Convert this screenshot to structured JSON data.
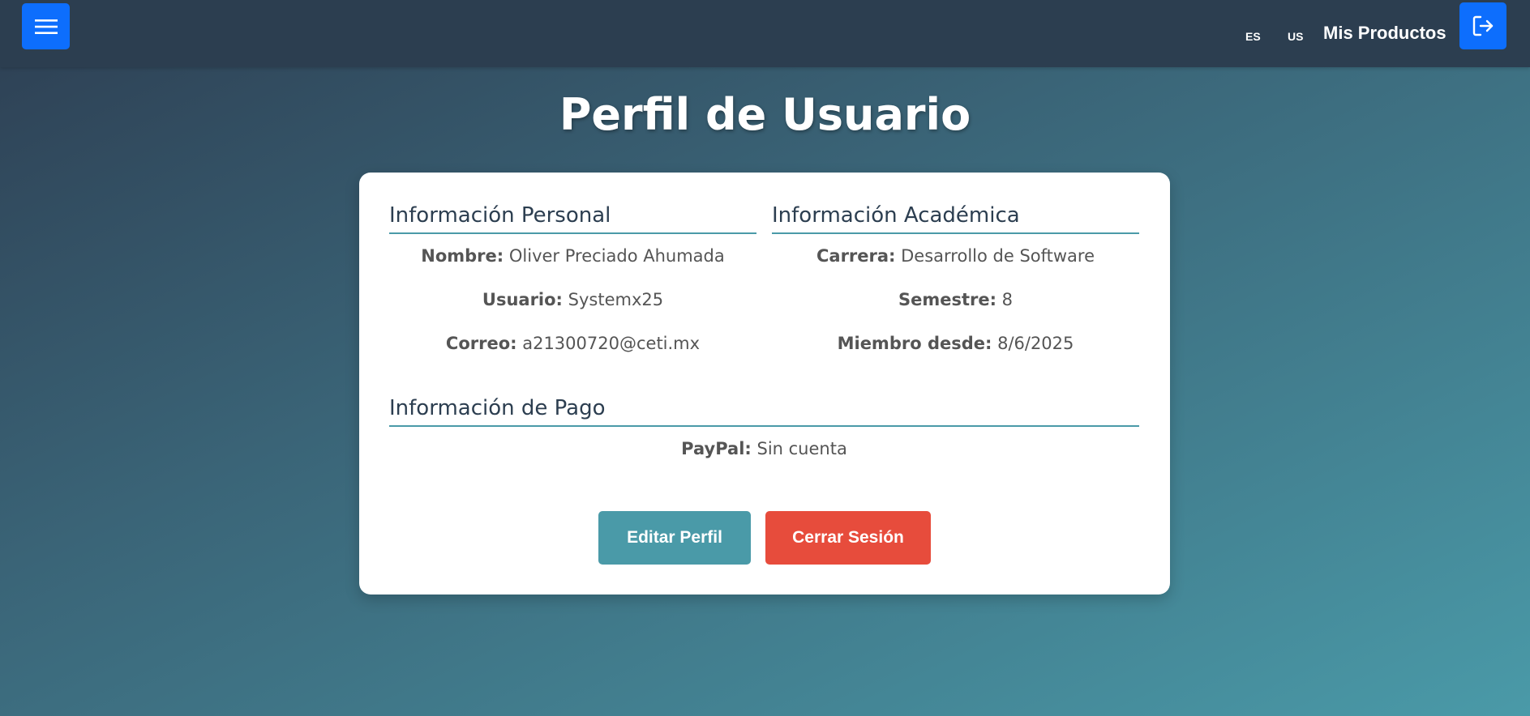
{
  "header": {
    "lang_es": "ES",
    "lang_us": "US",
    "mis_productos": "Mis Productos",
    "menu_icon": "hamburger-menu-icon",
    "logout_icon": "logout-icon"
  },
  "page": {
    "title": "Perfil de Usuario"
  },
  "personal": {
    "heading": "Información Personal",
    "fields": [
      {
        "label": "Nombre:",
        "value": "Oliver Preciado Ahumada"
      },
      {
        "label": "Usuario:",
        "value": "Systemx25"
      },
      {
        "label": "Correo:",
        "value": "a21300720@ceti.mx"
      }
    ]
  },
  "academic": {
    "heading": "Información Académica",
    "fields": [
      {
        "label": "Carrera:",
        "value": "Desarrollo de Software"
      },
      {
        "label": "Semestre:",
        "value": "8"
      },
      {
        "label": "Miembro desde:",
        "value": "8/6/2025"
      }
    ]
  },
  "payment": {
    "heading": "Información de Pago",
    "fields": [
      {
        "label": "PayPal:",
        "value": "Sin cuenta"
      }
    ]
  },
  "actions": {
    "edit_label": "Editar Perfil",
    "logout_label": "Cerrar Sesión"
  },
  "colors": {
    "navbar": "#2c3e50",
    "primary_button": "#0d6efd",
    "accent": "#4a9aa8",
    "danger": "#e74c3c"
  }
}
